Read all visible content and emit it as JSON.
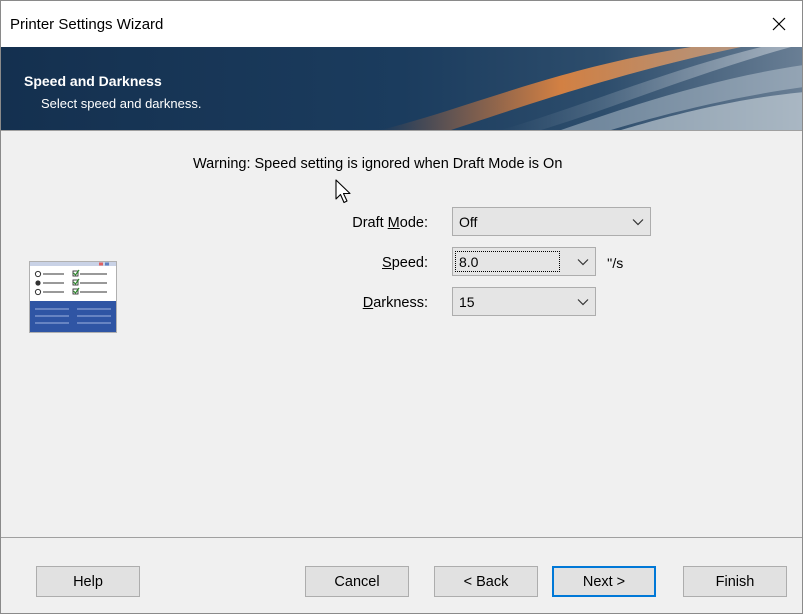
{
  "window": {
    "title": "Printer Settings Wizard"
  },
  "header": {
    "title": "Speed and Darkness",
    "subtitle": "Select speed and darkness."
  },
  "warning": "Warning: Speed setting is ignored when Draft Mode is On",
  "fields": {
    "draft_mode": {
      "label_pre": "Draft ",
      "label_accel": "M",
      "label_post": "ode:",
      "value": "Off"
    },
    "speed": {
      "label_pre": "",
      "label_accel": "S",
      "label_post": "peed:",
      "value": "8.0",
      "unit": "''/s"
    },
    "darkness": {
      "label_pre": "",
      "label_accel": "D",
      "label_post": "arkness:",
      "value": "15"
    }
  },
  "buttons": {
    "help": "Help",
    "cancel": "Cancel",
    "back": "< Back",
    "next": "Next >",
    "finish": "Finish"
  },
  "colors": {
    "accent": "#0078d7",
    "header_bg": "#183858"
  }
}
